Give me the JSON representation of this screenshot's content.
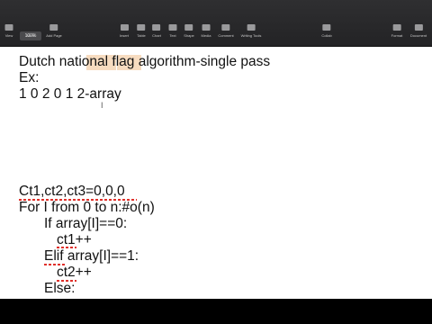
{
  "toolbar": {
    "zoom": "100%",
    "left_items": [
      {
        "icon": "view-icon",
        "label": "View"
      },
      {
        "icon": "zoom-icon",
        "label": "Zoom"
      },
      {
        "icon": "add-page-icon",
        "label": "Add Page"
      }
    ],
    "center_items": [
      {
        "icon": "insert-icon",
        "label": "Insert"
      },
      {
        "icon": "table-icon",
        "label": "Table"
      },
      {
        "icon": "chart-icon",
        "label": "Chart"
      },
      {
        "icon": "text-icon",
        "label": "Text"
      },
      {
        "icon": "shape-icon",
        "label": "Shape"
      },
      {
        "icon": "media-icon",
        "label": "Media"
      },
      {
        "icon": "comment-icon",
        "label": "Comment"
      },
      {
        "icon": "writing-tools-icon",
        "label": "Writing Tools"
      }
    ],
    "right_items": [
      {
        "icon": "collaborate-icon",
        "label": "Collab"
      },
      {
        "icon": "format-icon",
        "label": "Format"
      },
      {
        "icon": "document-icon",
        "label": "Document"
      }
    ]
  },
  "document": {
    "lines": [
      "Dutch national flag algorithm-single pass",
      "Ex:",
      "1 0 2 0 1 2-array",
      "Ct1,ct2,ct3=0,0,0",
      "For I from 0 to n:#o(n)",
      "If array[I]==0:",
      "ct1++",
      "Elif array[I]==1:",
      "ct2++",
      "Else:"
    ]
  },
  "colors": {
    "toolbar_bg": "#2a2a2c",
    "highlight": "#f7dcc0",
    "spellcheck_underline": "#e0302a",
    "text": "#111111"
  }
}
